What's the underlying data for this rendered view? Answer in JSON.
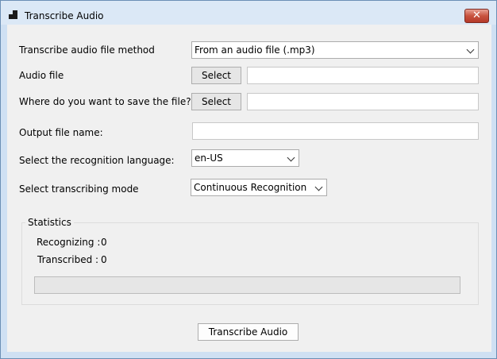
{
  "window": {
    "title": "Transcribe Audio",
    "close_glyph": "✕"
  },
  "form": {
    "method_label": "Transcribe audio file method",
    "method_value": "From an audio file (.mp3)",
    "audio_label": "Audio file",
    "audio_select": "Select",
    "audio_path": "",
    "save_label": "Where do you want to save the file?",
    "save_select": "Select",
    "save_path": "",
    "output_label": "Output file name:",
    "output_value": "",
    "language_label": "Select the recognition language:",
    "language_value": "en-US",
    "mode_label": "Select transcribing mode",
    "mode_value": "Continuous Recognition"
  },
  "statistics": {
    "title": "Statistics",
    "recognizing_label": "Recognizing :",
    "recognizing_value": "0",
    "transcribed_label": "Transcribed :",
    "transcribed_value": "0",
    "progress": 0
  },
  "actions": {
    "transcribe_label": "Transcribe Audio"
  }
}
